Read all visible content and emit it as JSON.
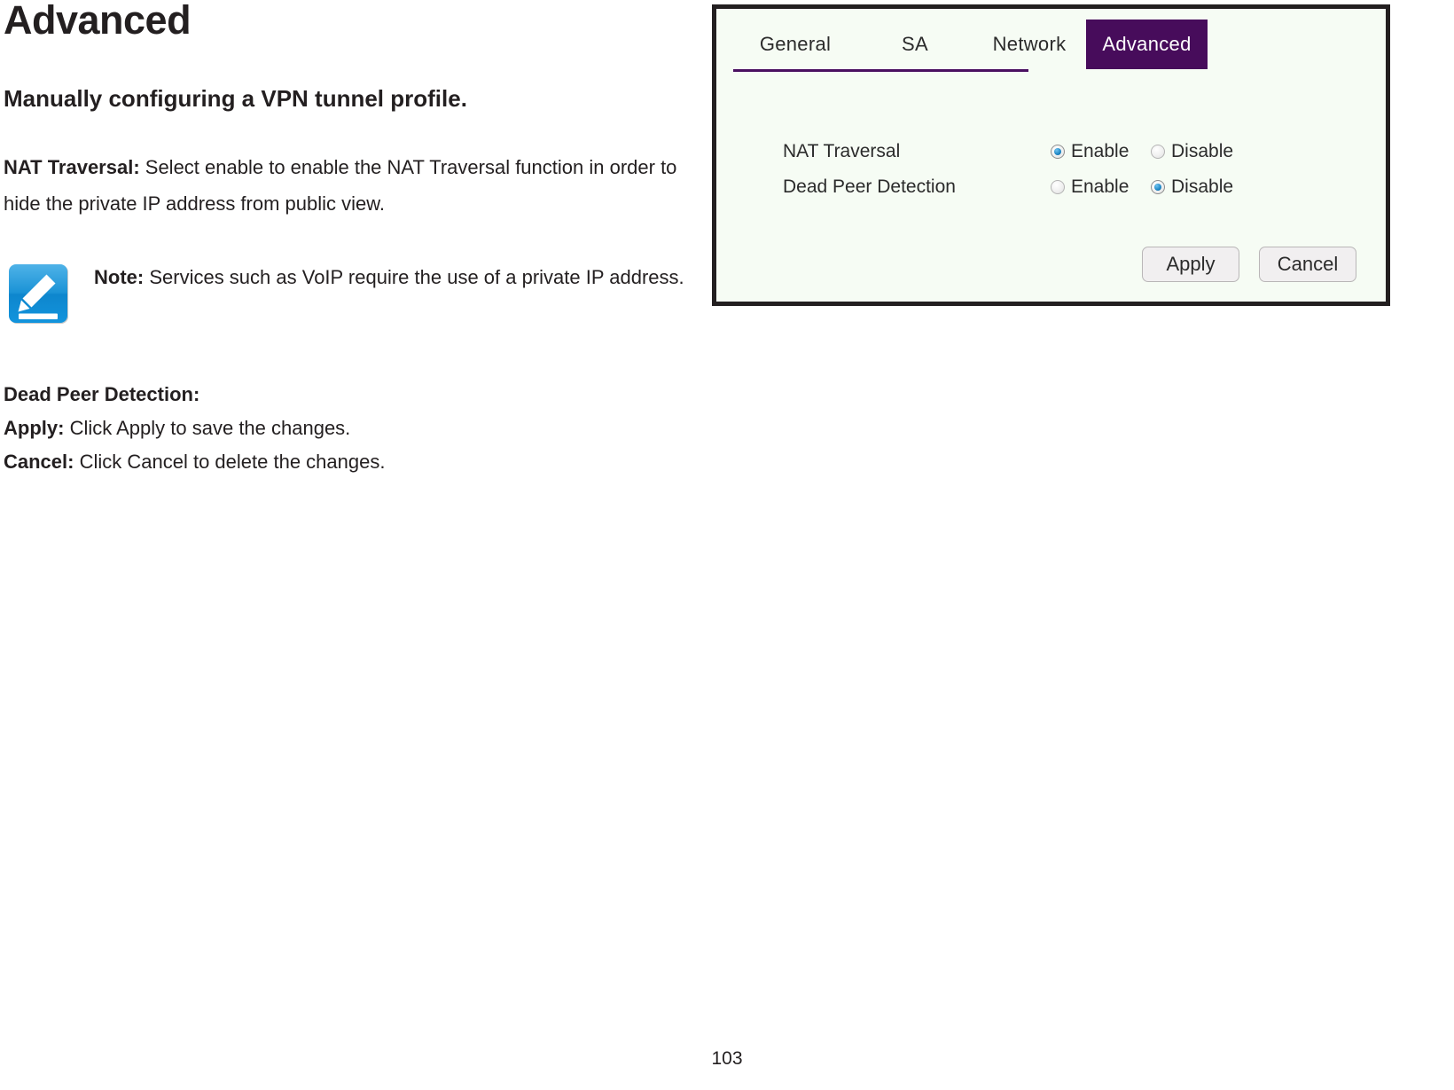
{
  "document": {
    "heading": "Advanced",
    "subheading": "Manually configuring a VPN tunnel profile.",
    "nat_label": "NAT Traversal:",
    "nat_text": " Select enable to enable the NAT Traversal function in order to hide the private IP address from public view.",
    "note_label": "Note:",
    "note_text": " Services such as VoIP require the use of a private IP address.",
    "dpd_title": "Dead Peer Detection:",
    "apply_label": "Apply:",
    "apply_text": " Click Apply to save the changes.",
    "cancel_label": "Cancel:",
    "cancel_text": " Click Cancel to delete the changes."
  },
  "screenshot": {
    "tabs": [
      {
        "label": "General",
        "active": false
      },
      {
        "label": "SA",
        "active": false
      },
      {
        "label": "Network",
        "active": false
      },
      {
        "label": "Advanced",
        "active": true
      }
    ],
    "rows": [
      {
        "label": "NAT Traversal",
        "enable_label": "Enable",
        "disable_label": "Disable",
        "selected": "Enable"
      },
      {
        "label": "Dead Peer Detection",
        "enable_label": "Enable",
        "disable_label": "Disable",
        "selected": "Disable"
      }
    ],
    "buttons": {
      "apply": "Apply",
      "cancel": "Cancel"
    },
    "colors": {
      "active_tab_bg": "#470c5b",
      "underline": "#4a1060",
      "panel_bg": "#f6fcf4",
      "panel_border": "#231f20",
      "radio_selected": "#1e86c4"
    }
  },
  "footer": {
    "page_number": "103"
  }
}
